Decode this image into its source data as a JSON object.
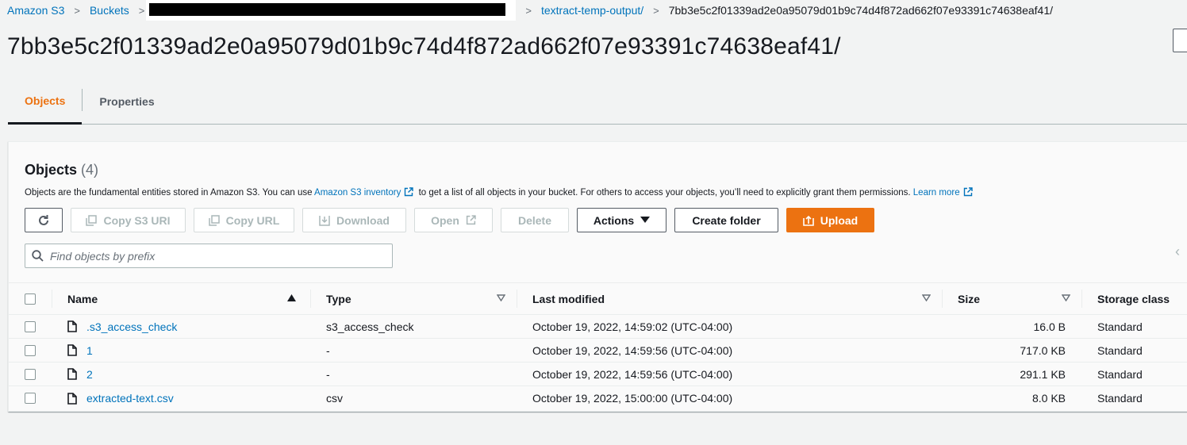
{
  "breadcrumb": {
    "items": [
      "Amazon S3",
      "Buckets",
      "textract-temp-output/"
    ],
    "current": "7bb3e5c2f01339ad2e0a95079d01b9c74d4f872ad662f07e93391c74638eaf41/"
  },
  "page": {
    "title": "7bb3e5c2f01339ad2e0a95079d01b9c74d4f872ad662f07e93391c74638eaf41/"
  },
  "tabs": [
    {
      "label": "Objects",
      "active": true
    },
    {
      "label": "Properties",
      "active": false
    }
  ],
  "objects_panel": {
    "title": "Objects",
    "count": "(4)",
    "description_pre": "Objects are the fundamental entities stored in Amazon S3. You can use",
    "inventory_link": "Amazon S3 inventory",
    "description_mid": "to get a list of all objects in your bucket. For others to access your objects, you’ll need to explicitly grant them permissions.",
    "learn_more": "Learn more"
  },
  "toolbar": {
    "copy_s3_uri": "Copy S3 URI",
    "copy_url": "Copy URL",
    "download": "Download",
    "open": "Open",
    "delete": "Delete",
    "actions": "Actions",
    "create_folder": "Create folder",
    "upload": "Upload"
  },
  "search": {
    "placeholder": "Find objects by prefix"
  },
  "table": {
    "columns": [
      "Name",
      "Type",
      "Last modified",
      "Size",
      "Storage class"
    ],
    "rows": [
      {
        "name": ".s3_access_check",
        "type": "s3_access_check",
        "modified": "October 19, 2022, 14:59:02 (UTC-04:00)",
        "size": "16.0 B",
        "class": "Standard"
      },
      {
        "name": "1",
        "type": "-",
        "modified": "October 19, 2022, 14:59:56 (UTC-04:00)",
        "size": "717.0 KB",
        "class": "Standard"
      },
      {
        "name": "2",
        "type": "-",
        "modified": "October 19, 2022, 14:59:56 (UTC-04:00)",
        "size": "291.1 KB",
        "class": "Standard"
      },
      {
        "name": "extracted-text.csv",
        "type": "csv",
        "modified": "October 19, 2022, 15:00:00 (UTC-04:00)",
        "size": "8.0 KB",
        "class": "Standard"
      }
    ]
  },
  "colors": {
    "accent": "#ec7211",
    "link": "#0073bb",
    "text": "#16191f"
  }
}
